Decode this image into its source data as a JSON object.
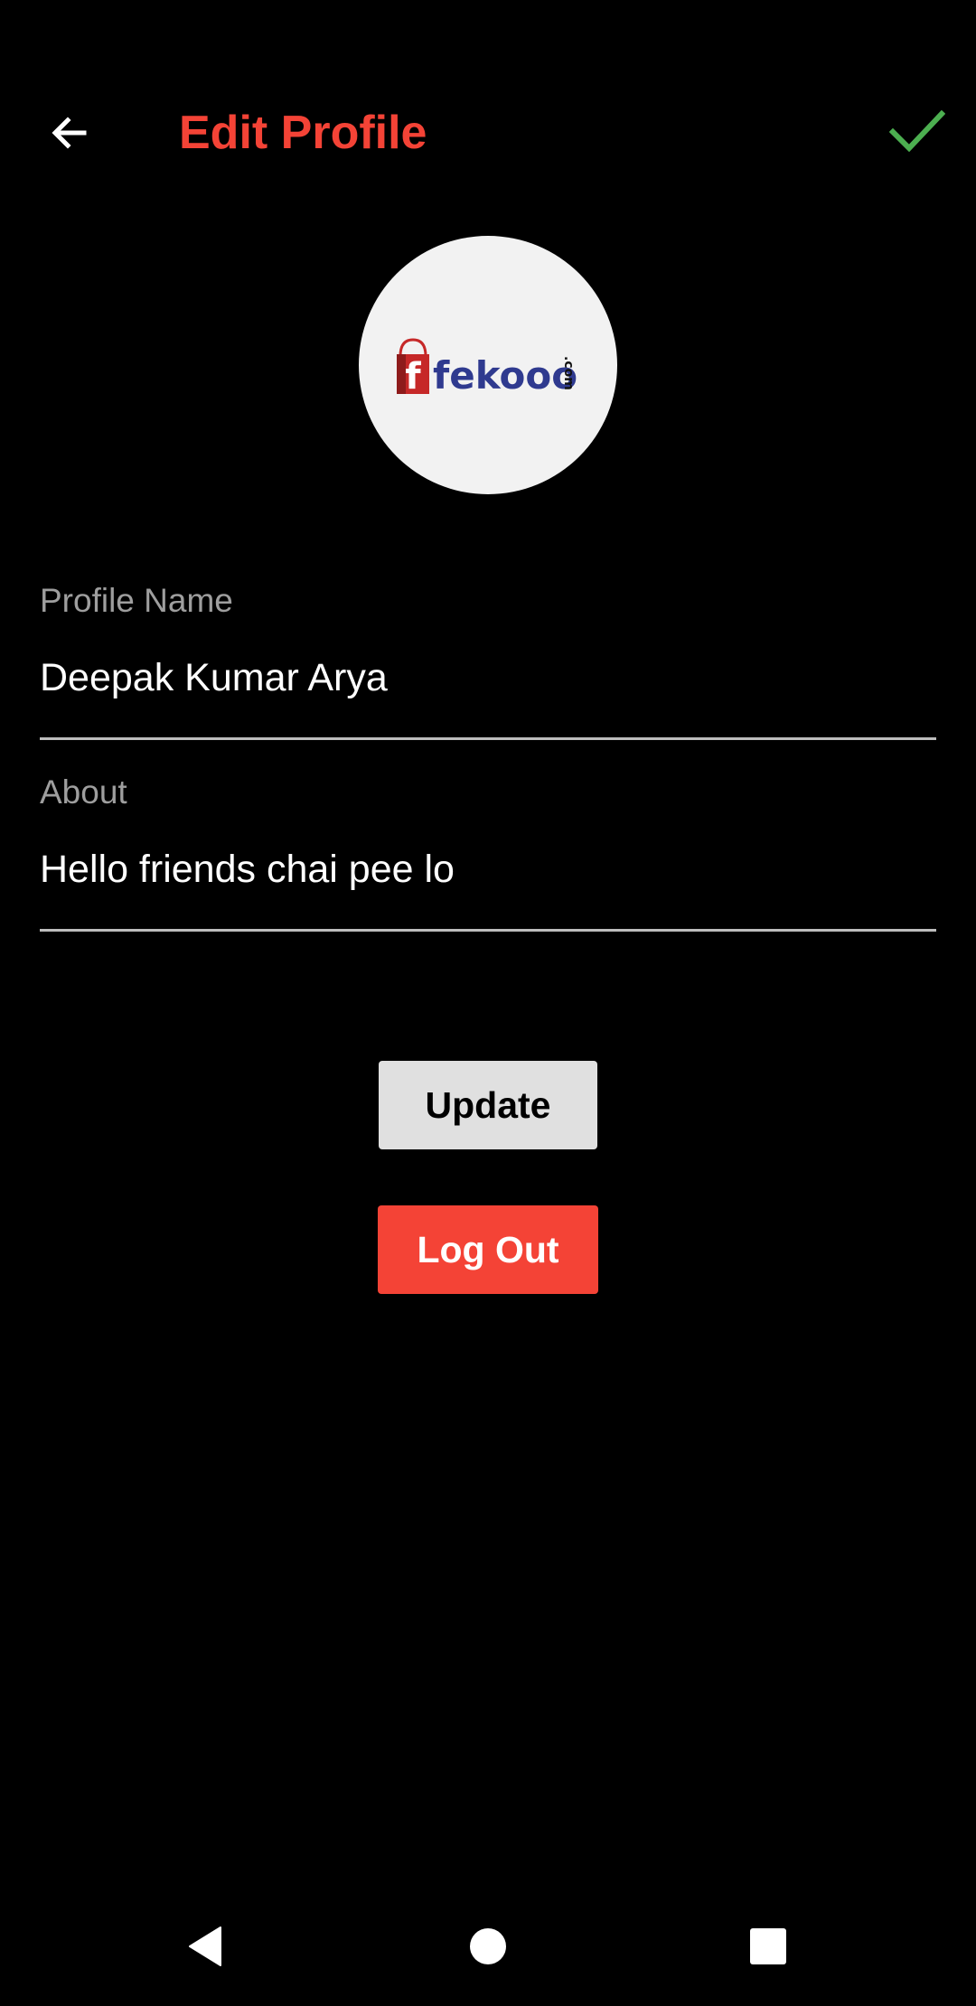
{
  "header": {
    "title": "Edit Profile",
    "back_icon": "arrow-left-icon",
    "confirm_icon": "check-icon",
    "title_color": "#f44336",
    "confirm_color": "#4caf50"
  },
  "avatar": {
    "logo_text": "fekooo",
    "logo_suffix": ".com"
  },
  "form": {
    "profile_name": {
      "label": "Profile Name",
      "value": "Deepak Kumar Arya"
    },
    "about": {
      "label": "About",
      "value": "Hello friends chai pee lo"
    }
  },
  "actions": {
    "update_label": "Update",
    "logout_label": "Log Out",
    "logout_color": "#f44336"
  },
  "system_nav": {
    "back_icon": "triangle-back-icon",
    "home_icon": "circle-home-icon",
    "recents_icon": "square-recents-icon"
  }
}
